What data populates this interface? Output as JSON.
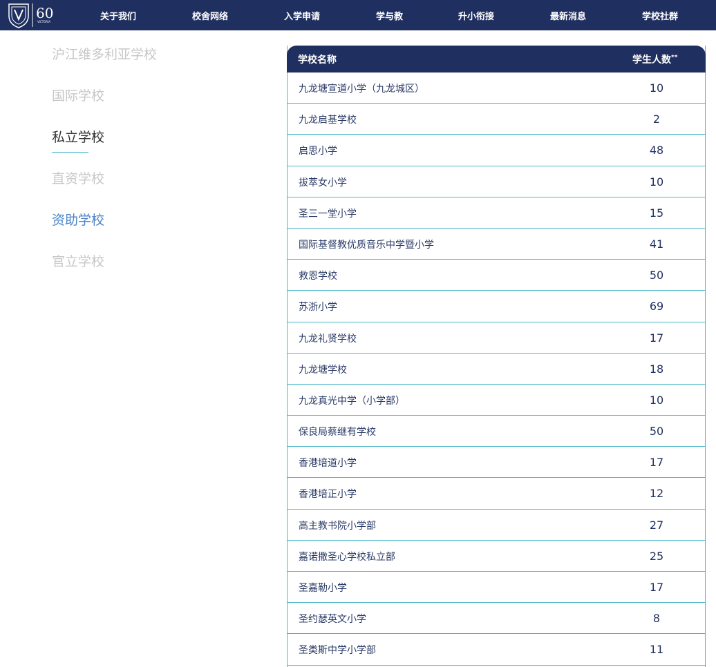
{
  "header": {
    "logo_text": "VICTORIA",
    "logo_anniversary": "60",
    "nav": [
      "关于我们",
      "校舍网络",
      "入学申请",
      "学与教",
      "升小衔接",
      "最新消息",
      "学校社群"
    ]
  },
  "sidebar": {
    "items": [
      {
        "label": "沪江维多利亚学校",
        "state": "inactive"
      },
      {
        "label": "国际学校",
        "state": "inactive"
      },
      {
        "label": "私立学校",
        "state": "active"
      },
      {
        "label": "直资学校",
        "state": "inactive"
      },
      {
        "label": "资助学校",
        "state": "hover"
      },
      {
        "label": "官立学校",
        "state": "inactive"
      }
    ]
  },
  "table": {
    "header_name": "学校名称",
    "header_count": "学生人数",
    "header_count_sup": "**",
    "rows": [
      {
        "name": "九龙塘宣道小学（九龙城区）",
        "count": "10"
      },
      {
        "name": "九龙启基学校",
        "count": "2"
      },
      {
        "name": "启思小学",
        "count": "48"
      },
      {
        "name": "拔萃女小学",
        "count": "10"
      },
      {
        "name": "圣三一堂小学",
        "count": "15"
      },
      {
        "name": "国际基督教优质音乐中学暨小学",
        "count": "41"
      },
      {
        "name": "救恩学校",
        "count": "50"
      },
      {
        "name": "苏浙小学",
        "count": "69"
      },
      {
        "name": "九龙礼贤学校",
        "count": "17"
      },
      {
        "name": "九龙塘学校",
        "count": "18"
      },
      {
        "name": "九龙真光中学（小学部）",
        "count": "10"
      },
      {
        "name": "保良局蔡继有学校",
        "count": "50"
      },
      {
        "name": "香港培道小学",
        "count": "17"
      },
      {
        "name": "香港培正小学",
        "count": "12"
      },
      {
        "name": "高主教书院小学部",
        "count": "27"
      },
      {
        "name": "嘉诺撒圣心学校私立部",
        "count": "25"
      },
      {
        "name": "圣嘉勒小学",
        "count": "17"
      },
      {
        "name": "圣约瑟英文小学",
        "count": "8"
      },
      {
        "name": "圣类斯中学小学部",
        "count": "11"
      }
    ]
  },
  "colors": {
    "navy": "#1f2f5f",
    "teal": "#49b7c9",
    "link_blue": "#4a84c8"
  }
}
